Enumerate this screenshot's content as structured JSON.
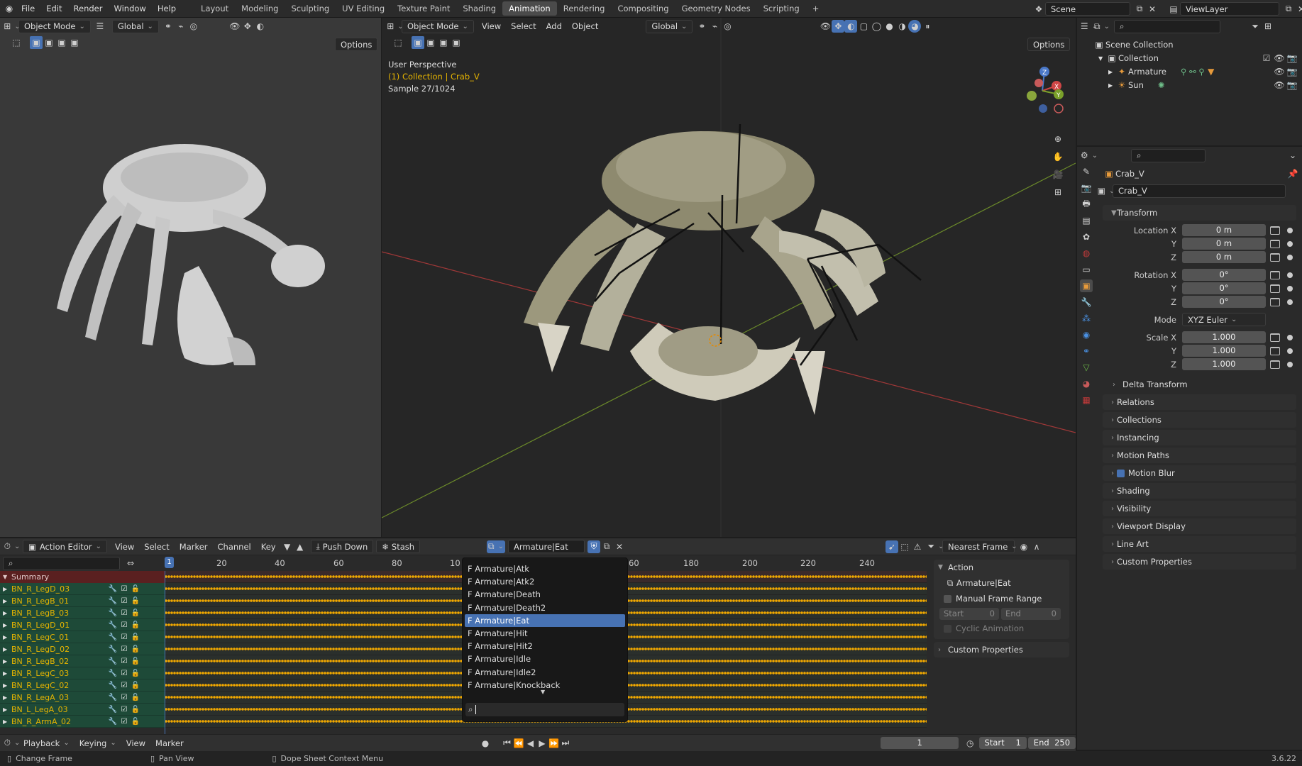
{
  "topbar": {
    "menus": [
      "File",
      "Edit",
      "Render",
      "Window",
      "Help"
    ],
    "workspaces": [
      "Layout",
      "Modeling",
      "Sculpting",
      "UV Editing",
      "Texture Paint",
      "Shading",
      "Animation",
      "Rendering",
      "Compositing",
      "Geometry Nodes",
      "Scripting"
    ],
    "active_workspace": "Animation",
    "scene": "Scene",
    "view_layer": "ViewLayer"
  },
  "left_viewport": {
    "mode": "Object Mode",
    "transform": "Global",
    "options": "Options"
  },
  "main_viewport": {
    "mode": "Object Mode",
    "menus": [
      "View",
      "Select",
      "Add",
      "Object"
    ],
    "transform": "Global",
    "options": "Options",
    "overlay_text": {
      "perspective": "User Perspective",
      "collection": "(1) Collection | Crab_V",
      "sample": "Sample 27/1024"
    }
  },
  "outliner": {
    "root": "Scene Collection",
    "collection": "Collection",
    "items": [
      "Armature",
      "Sun"
    ]
  },
  "properties": {
    "object_name": "Crab_V",
    "data_name": "Crab_V",
    "transform_header": "Transform",
    "location": {
      "label": "Location X",
      "x": "0 m",
      "y": "0 m",
      "z": "0 m"
    },
    "rotation": {
      "label": "Rotation X",
      "x": "0°",
      "y": "0°",
      "z": "0°"
    },
    "mode": {
      "label": "Mode",
      "value": "XYZ Euler"
    },
    "scale": {
      "label": "Scale X",
      "x": "1.000",
      "y": "1.000",
      "z": "1.000"
    },
    "axis_y": "Y",
    "axis_z": "Z",
    "delta": "Delta Transform",
    "panels": [
      "Relations",
      "Collections",
      "Instancing",
      "Motion Paths",
      "Motion Blur",
      "Shading",
      "Visibility",
      "Viewport Display",
      "Line Art",
      "Custom Properties"
    ]
  },
  "dope_sheet": {
    "editor": "Action Editor",
    "menus": [
      "View",
      "Select",
      "Marker",
      "Channel",
      "Key"
    ],
    "push_down": "Push Down",
    "stash": "Stash",
    "action": "Armature|Eat",
    "snap": "Nearest Frame",
    "frame_numbers": [
      "20",
      "40",
      "60",
      "80",
      "10",
      "60",
      "180",
      "200",
      "220",
      "240"
    ],
    "current_frame_marker": "1",
    "summary": "Summary",
    "channels": [
      "BN_R_LegD_03",
      "BN_R_LegB_01",
      "BN_R_LegB_03",
      "BN_R_LegD_01",
      "BN_R_LegC_01",
      "BN_R_LegD_02",
      "BN_R_LegB_02",
      "BN_R_LegC_03",
      "BN_R_LegC_02",
      "BN_R_LegA_03",
      "BN_L_LegA_03",
      "BN_R_ArmA_02"
    ]
  },
  "action_popup": {
    "items": [
      "F Armature|Atk",
      "F Armature|Atk2",
      "F Armature|Death",
      "F Armature|Death2",
      "F Armature|Eat",
      "F Armature|Hit",
      "F Armature|Hit2",
      "F Armature|Idle",
      "F Armature|Idle2",
      "F Armature|Knockback"
    ],
    "selected_index": 4,
    "search_value": ""
  },
  "action_panel": {
    "header": "Action",
    "action_name": "Armature|Eat",
    "manual_range": "Manual Frame Range",
    "start_label": "Start",
    "start_value": "0",
    "end_label": "End",
    "end_value": "0",
    "cyclic": "Cyclic Animation",
    "custom_props": "Custom Properties"
  },
  "timeline": {
    "menus": [
      "Playback",
      "Keying",
      "View",
      "Marker"
    ],
    "current_frame": "1",
    "start_label": "Start",
    "start": "1",
    "end_label": "End",
    "end": "250"
  },
  "statusbar": {
    "hints": [
      "Change Frame",
      "Pan View",
      "Dope Sheet Context Menu"
    ],
    "version": "3.6.22"
  },
  "colors": {
    "accent": "#4772b3",
    "keyframe": "#f0a800",
    "channel_bg": "#1e4a38",
    "active_tab": "#4b4b4b"
  }
}
